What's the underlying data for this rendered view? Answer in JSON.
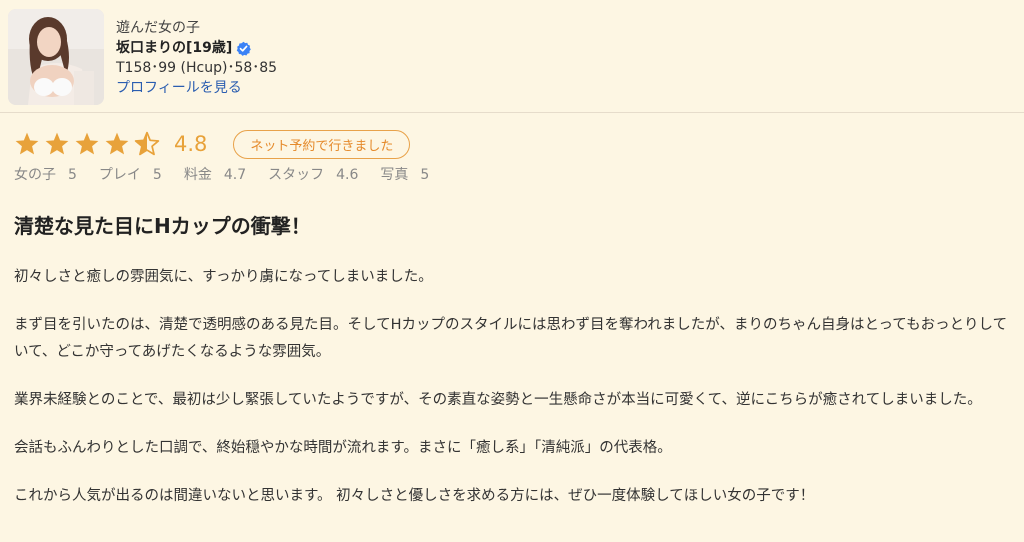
{
  "girl": {
    "caption": "遊んだ女の子",
    "name": "坂口まりの[19歳]",
    "stats": "T158･99 (Hcup)･58･85",
    "profile_link": "プロフィールを見る"
  },
  "rating": {
    "score": "4.8",
    "stars": 4.5,
    "visit_badge": "ネット予約で行きました",
    "star_color": "#e8a23a",
    "subscores": [
      {
        "label": "女の子",
        "value": "5"
      },
      {
        "label": "プレイ",
        "value": "5"
      },
      {
        "label": "料金",
        "value": "4.7"
      },
      {
        "label": "スタッフ",
        "value": "4.6"
      },
      {
        "label": "写真",
        "value": "5"
      }
    ]
  },
  "review": {
    "title": "清楚な見た目にHカップの衝撃！",
    "paragraphs": [
      "初々しさと癒しの雰囲気に、すっかり虜になってしまいました。",
      "まず目を引いたのは、清楚で透明感のある見た目。そしてHカップのスタイルには思わず目を奪われましたが、まりのちゃん自身はとってもおっとりしていて、どこか守ってあげたくなるような雰囲気。",
      "業界未経験とのことで、最初は少し緊張していたようですが、その素直な姿勢と一生懸命さが本当に可愛くて、逆にこちらが癒されてしまいました。",
      "会話もふんわりとした口調で、終始穏やかな時間が流れます。まさに「癒し系」「清純派」の代表格。",
      "これから人気が出るのは間違いないと思います。 初々しさと優しさを求める方には、ぜひ一度体験してほしい女の子です！"
    ]
  }
}
